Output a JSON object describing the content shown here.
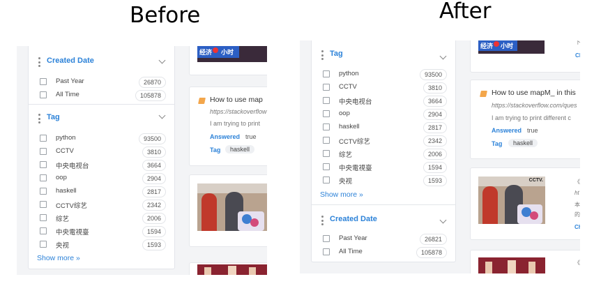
{
  "headings": {
    "before": "Before",
    "after": "After"
  },
  "common": {
    "show_more": "Show more »",
    "answered_label": "Answered",
    "answered_value": "true",
    "tag_label": "Tag",
    "tag_value": "haskell",
    "question_title_before": "How to use map",
    "question_title_after": "How to use mapM_ in this",
    "question_url_before": "https://stackoverflow",
    "question_url_after": "https://stackoverflow.com/ques",
    "question_snippet_before": "I am trying to print",
    "question_snippet_after": "I am trying to print different c",
    "banner_text": "经济",
    "banner_text2": "小时"
  },
  "before": {
    "created_date": {
      "title": "Created Date",
      "options": [
        {
          "label": "Past Year",
          "count": "26870"
        },
        {
          "label": "All Time",
          "count": "105878"
        }
      ]
    },
    "tag": {
      "title": "Tag",
      "options": [
        {
          "label": "python",
          "count": "93500"
        },
        {
          "label": "CCTV",
          "count": "3810"
        },
        {
          "label": "中央电视台",
          "count": "3664"
        },
        {
          "label": "oop",
          "count": "2904"
        },
        {
          "label": "haskell",
          "count": "2817"
        },
        {
          "label": "CCTV综艺",
          "count": "2342"
        },
        {
          "label": "综艺",
          "count": "2006"
        },
        {
          "label": "中央電視臺",
          "count": "1594"
        },
        {
          "label": "央视",
          "count": "1593"
        }
      ]
    }
  },
  "after": {
    "tag": {
      "title": "Tag",
      "options": [
        {
          "label": "python",
          "count": "93500"
        },
        {
          "label": "CCTV",
          "count": "3810"
        },
        {
          "label": "中央电视台",
          "count": "3664"
        },
        {
          "label": "oop",
          "count": "2904"
        },
        {
          "label": "haskell",
          "count": "2817"
        },
        {
          "label": "CCTV综艺",
          "count": "2342"
        },
        {
          "label": "综艺",
          "count": "2006"
        },
        {
          "label": "中央電視臺",
          "count": "1594"
        },
        {
          "label": "央视",
          "count": "1593"
        }
      ]
    },
    "created_date": {
      "title": "Created Date",
      "options": [
        {
          "label": "Past Year",
          "count": "26821"
        },
        {
          "label": "All Time",
          "count": "105878"
        }
      ]
    },
    "side_fragments": {
      "top_a": "下",
      "top_b": "Ch",
      "video_logo": "CCTV.",
      "video_a": "《?",
      "video_b": "ht",
      "video_c": "本",
      "video_d": "的",
      "video_e": "Ch",
      "bottom": "《"
    }
  },
  "colors": {
    "accent": "#2c82d8",
    "panel_bg": "#f3f4f6",
    "border": "#e3e5ea"
  }
}
